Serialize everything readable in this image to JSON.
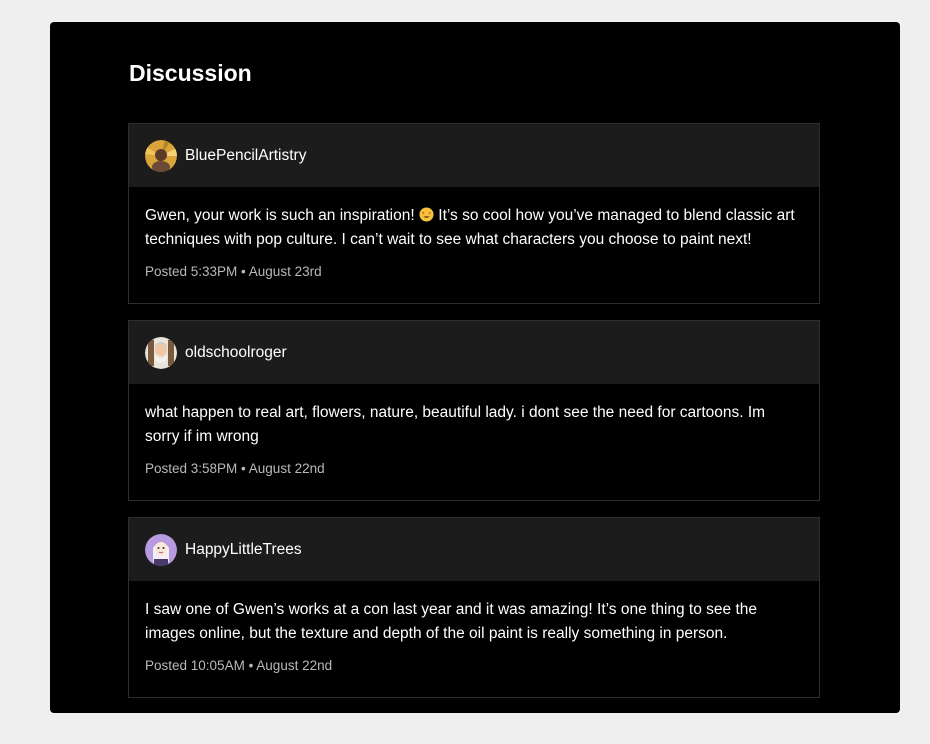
{
  "discussion": {
    "title": "Discussion",
    "comments": [
      {
        "username": "BluePencilArtistry",
        "text_before_emoji": "Gwen, your work is such an inspiration! ",
        "emoji": "star-struck-emoji",
        "text_after_emoji": " It’s so cool how you’ve managed to blend classic art techniques with pop culture. I can’t wait to see what characters you choose to paint next!",
        "posted": "Posted 5:33PM • August 23rd"
      },
      {
        "username": "oldschoolroger",
        "text": "what happen to real art, flowers, nature, beautiful lady. i dont see the need for cartoons. Im sorry if im wrong",
        "posted": "Posted 3:58PM • August 22nd"
      },
      {
        "username": "HappyLittleTrees",
        "text": "I saw one of Gwen’s works at a con last year and it was amazing! It’s one thing to see the images online, but the texture and depth of the oil paint is really something in person.",
        "posted": "Posted 10:05AM • August 22nd"
      }
    ]
  },
  "colors": {
    "page_background": "#efefef",
    "panel_background": "#000000",
    "comment_header": "#1c1c1c",
    "meta_text": "#b9b9b9"
  }
}
